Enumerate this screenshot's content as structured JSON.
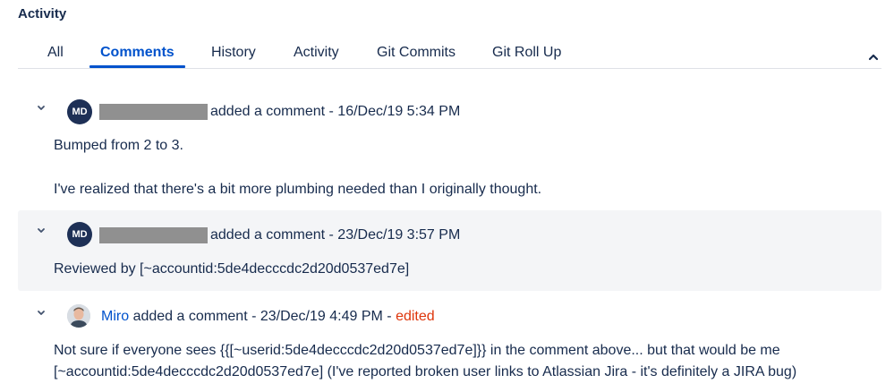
{
  "activity": {
    "title": "Activity",
    "tabs": [
      {
        "label": "All"
      },
      {
        "label": "Comments",
        "active": true
      },
      {
        "label": "History"
      },
      {
        "label": "Activity"
      },
      {
        "label": "Git Commits"
      },
      {
        "label": "Git Roll Up"
      }
    ],
    "collapse_icon": "chevron-up-icon"
  },
  "comments": [
    {
      "avatar_initials": "MD",
      "author_redacted": true,
      "header": "added a comment - 16/Dec/19 5:34 PM",
      "body": [
        "Bumped from 2 to 3.",
        "I've realized that there's a bit more plumbing needed than I originally thought."
      ]
    },
    {
      "avatar_initials": "MD",
      "author_redacted": true,
      "header": "added a comment - 23/Dec/19 3:57 PM",
      "body": [
        "Reviewed by [~accountid:5de4decccdc2d20d0537ed7e]"
      ]
    },
    {
      "avatar_initials": "",
      "author": "Miro",
      "header": "added a comment - 23/Dec/19 4:49 PM -",
      "edited_label": "edited",
      "body": [
        "Not sure if everyone sees {{[~userid:5de4decccdc2d20d0537ed7e]}} in the comment above... but that would be me",
        "[~accountid:5de4decccdc2d20d0537ed7e] (I've reported broken user links to Atlassian Jira - it's definitely a JIRA bug)"
      ]
    }
  ],
  "colors": {
    "accent": "#0052cc",
    "text": "#172b4d",
    "edited": "#de350b",
    "avatar_bg": "#1e3056",
    "highlight_bg": "#f4f5f7"
  }
}
